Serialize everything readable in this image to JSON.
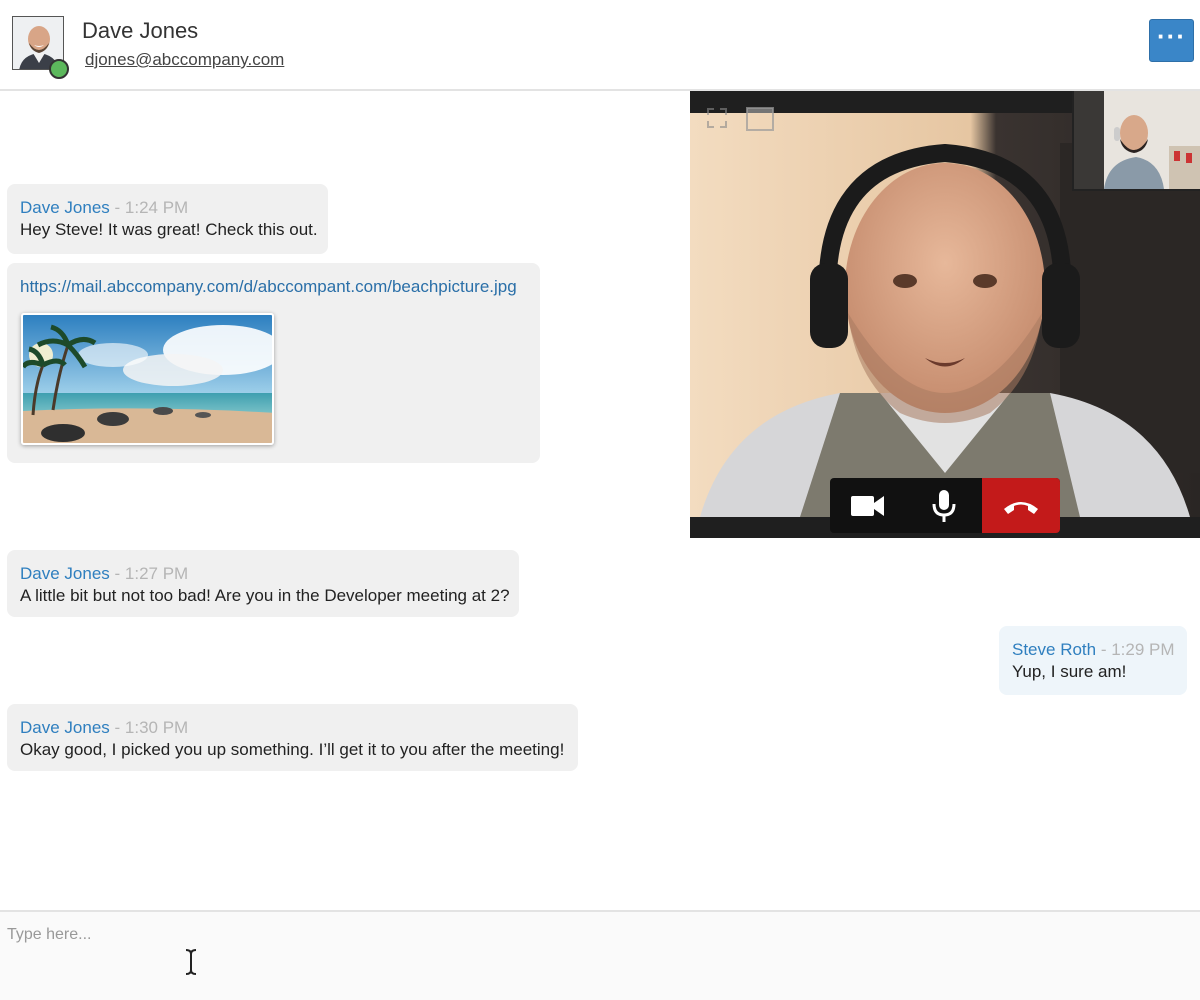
{
  "header": {
    "contact_name": "Dave Jones",
    "contact_email": "djones@abccompany.com",
    "presence": "online",
    "more_label": "···"
  },
  "messages": [
    {
      "sender": "Dave Jones",
      "time": "- 1:24 PM",
      "text": "Hey Steve!  It was great! Check this out."
    },
    {
      "link": "https://mail.abccompany.com/d/abccompant.com/beachpicture.jpg",
      "attachment": "beach image thumbnail"
    },
    {
      "sender": "Dave Jones",
      "time": "- 1:27 PM",
      "text": "A little bit but not too bad!  Are you in the Developer meeting at 2?"
    },
    {
      "sender": "Steve Roth",
      "time": "- 1:29 PM",
      "text": "Yup, I sure am!"
    },
    {
      "sender": "Dave Jones",
      "time": "- 1:30 PM",
      "text": "Okay good, I picked you up something.  I’ll get it to you after the meeting!"
    }
  ],
  "video": {
    "controls": [
      "video-camera-icon",
      "microphone-icon",
      "end-call-icon"
    ]
  },
  "composer": {
    "placeholder": "Type here..."
  },
  "colors": {
    "accent": "#3a86c8",
    "sender": "#2f7fbf",
    "end_call": "#c31a1a",
    "presence": "#5cb85c"
  }
}
